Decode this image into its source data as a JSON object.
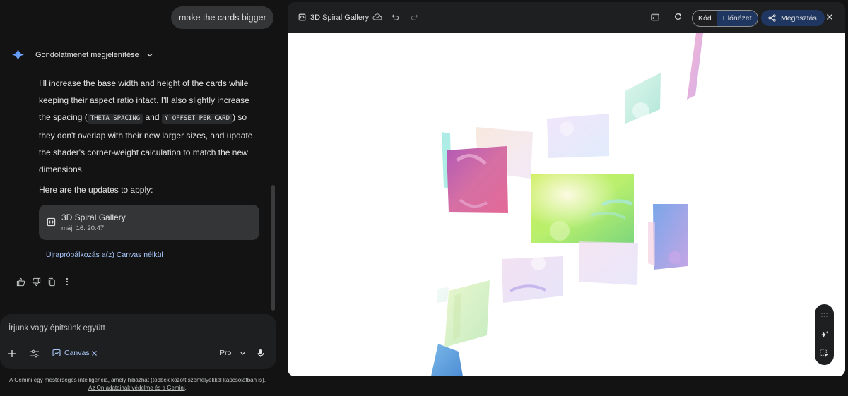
{
  "chat": {
    "user_message": "make the cards bigger",
    "thinking_label": "Gondolatmenet megjelenítése",
    "answer": {
      "p1_a": "I'll increase the base width and height of the cards while keeping their aspect ratio intact. I'll also slightly increase the spacing (",
      "code1": "THETA_SPACING",
      "p1_and": " and ",
      "code2": "Y_OFFSET_PER_CARD",
      "p1_b": ") so they don't overlap with their new larger sizes, and update the shader's corner-weight calculation to match the new dimensions.",
      "p2": "Here are the updates to apply:"
    },
    "file_card": {
      "title": "3D Spiral Gallery",
      "timestamp": "máj. 16. 20:47"
    },
    "retry_link": "Újrapróbálkozás a(z) Canvas nélkül"
  },
  "input": {
    "placeholder": "Írjunk vagy építsünk együtt",
    "canvas_chip": "Canvas",
    "model": "Pro"
  },
  "disclaimer": {
    "text": "A Gemini egy mesterséges intelligencia, amely hibázhat (többek között személyekkel kapcsolatban is).",
    "link": "Az Ön adatainak védelme és a Gemini"
  },
  "panel": {
    "title": "3D Spiral Gallery",
    "toggle": {
      "code": "Kód",
      "preview": "Előnézet",
      "active": "preview"
    },
    "share": "Megosztás"
  },
  "colors": {
    "background": "#131314",
    "surface": "#1e1f20",
    "bubble": "#333537",
    "accent": "#a8c7fa",
    "active_button": "#1f3760"
  }
}
